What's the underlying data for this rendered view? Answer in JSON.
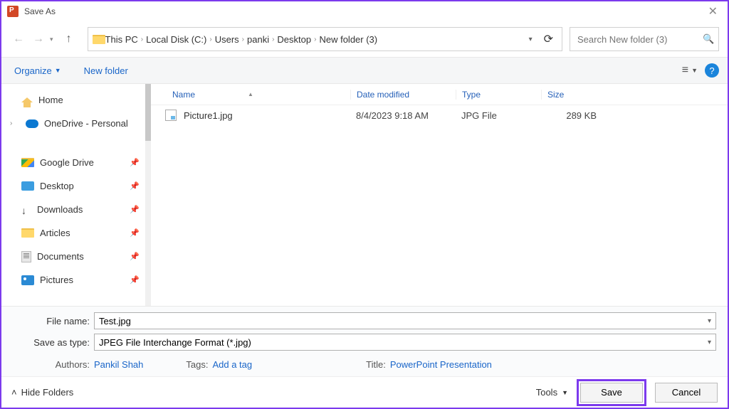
{
  "window": {
    "title": "Save As"
  },
  "breadcrumb": {
    "items": [
      "This PC",
      "Local Disk (C:)",
      "Users",
      "panki",
      "Desktop",
      "New folder (3)"
    ]
  },
  "search": {
    "placeholder": "Search New folder (3)"
  },
  "toolbar": {
    "organize": "Organize",
    "newfolder": "New folder"
  },
  "sidebar": {
    "home": "Home",
    "onedrive": "OneDrive - Personal",
    "gdrive": "Google Drive",
    "desktop": "Desktop",
    "downloads": "Downloads",
    "articles": "Articles",
    "documents": "Documents",
    "pictures": "Pictures"
  },
  "columns": {
    "name": "Name",
    "date": "Date modified",
    "type": "Type",
    "size": "Size"
  },
  "files": [
    {
      "name": "Picture1.jpg",
      "date": "8/4/2023 9:18 AM",
      "type": "JPG File",
      "size": "289 KB"
    }
  ],
  "fields": {
    "filename_label": "File name:",
    "filename_value": "Test.jpg",
    "savetype_label": "Save as type:",
    "savetype_value": "JPEG File Interchange Format (*.jpg)"
  },
  "meta": {
    "authors_label": "Authors:",
    "authors_value": "Pankil Shah",
    "tags_label": "Tags:",
    "tags_value": "Add a tag",
    "title_label": "Title:",
    "title_value": "PowerPoint Presentation"
  },
  "footer": {
    "hide_folders": "Hide Folders",
    "tools": "Tools",
    "save": "Save",
    "cancel": "Cancel"
  }
}
